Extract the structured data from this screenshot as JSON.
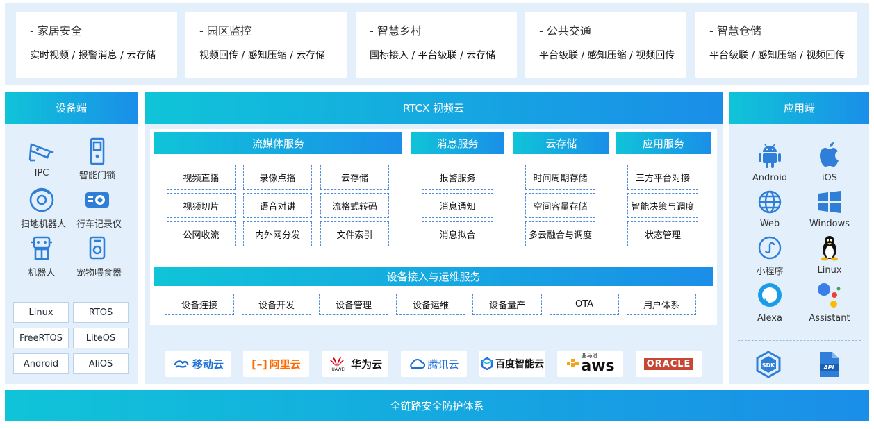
{
  "scenarios": [
    {
      "title": "- 家居安全",
      "sub": "实时视频 / 报警消息 / 云存储"
    },
    {
      "title": "- 园区监控",
      "sub": "视频回传 / 感知压缩 / 云存储"
    },
    {
      "title": "- 智慧乡村",
      "sub": "国标接入 / 平台级联 / 云存储"
    },
    {
      "title": "- 公共交通",
      "sub": "平台级联 / 感知压缩 / 视频回传"
    },
    {
      "title": "- 智慧仓储",
      "sub": "平台级联 / 感知压缩 / 视频回传"
    }
  ],
  "device": {
    "title": "设备端",
    "items": [
      {
        "label": "IPC",
        "icon": "camera-icon"
      },
      {
        "label": "智能门锁",
        "icon": "door-lock-icon"
      },
      {
        "label": "扫地机器人",
        "icon": "robot-vacuum-icon"
      },
      {
        "label": "行车记录仪",
        "icon": "dashcam-icon"
      },
      {
        "label": "机器人",
        "icon": "robot-icon"
      },
      {
        "label": "宠物喂食器",
        "icon": "pet-feeder-icon"
      }
    ],
    "os": [
      "Linux",
      "RTOS",
      "FreeRTOS",
      "LiteOS",
      "Android",
      "AliOS"
    ]
  },
  "cloud": {
    "title": "RTCX 视频云",
    "streaming": {
      "title": "流媒体服务",
      "cells": [
        "视频直播",
        "录像点播",
        "云存储",
        "视频切片",
        "语音对讲",
        "流格式转码",
        "公网收流",
        "内外网分发",
        "文件索引"
      ]
    },
    "message": {
      "title": "消息服务",
      "cells": [
        "报警服务",
        "消息通知",
        "消息拟合"
      ]
    },
    "storage": {
      "title": "云存储",
      "cells": [
        "时间周期存储",
        "空间容量存储",
        "多云融合与调度"
      ]
    },
    "appsvc": {
      "title": "应用服务",
      "cells": [
        "三方平台对接",
        "智能决策与调度",
        "状态管理"
      ]
    },
    "ops": {
      "title": "设备接入与运维服务",
      "cells": [
        "设备连接",
        "设备开发",
        "设备管理",
        "设备运维",
        "设备量产",
        "OTA",
        "用户体系"
      ]
    },
    "vendors": [
      "移动云",
      "阿里云",
      "华为云",
      "腾讯云",
      "百度智能云",
      "aws",
      "ORACLE"
    ],
    "vendor_sub": {
      "huawei": "HUAWEI",
      "aws": "亚马逊"
    }
  },
  "apps": {
    "title": "应用端",
    "items": [
      {
        "label": "Android",
        "icon": "android-icon"
      },
      {
        "label": "iOS",
        "icon": "apple-icon"
      },
      {
        "label": "Web",
        "icon": "globe-icon"
      },
      {
        "label": "Windows",
        "icon": "windows-icon"
      },
      {
        "label": "小程序",
        "icon": "mini-program-icon"
      },
      {
        "label": "Linux",
        "icon": "linux-penguin-icon"
      },
      {
        "label": "Alexa",
        "icon": "alexa-icon"
      },
      {
        "label": "Assistant",
        "icon": "google-assistant-icon"
      }
    ],
    "sdk": "SDK",
    "api": "API"
  },
  "footer": "全链路安全防护体系"
}
